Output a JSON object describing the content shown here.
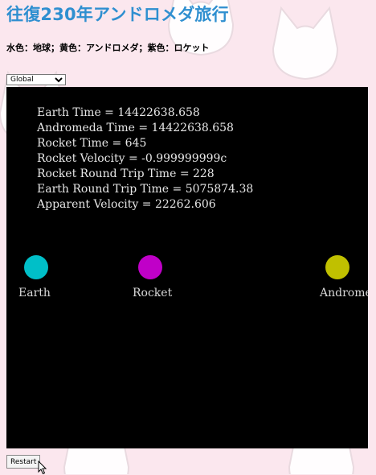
{
  "page": {
    "title": "往復230年アンドロメダ旅行",
    "legend": "水色：地球；黄色：アンドロメダ；紫色：ロケット"
  },
  "controls": {
    "frame_select": {
      "selected": "Global",
      "options": [
        "Global"
      ]
    },
    "restart_label": "Restart"
  },
  "simulation": {
    "readouts": [
      "Earth Time = 14422638.658",
      "Andromeda Time = 14422638.658",
      "Rocket Time = 645",
      "Rocket Velocity = -0.999999999c",
      "Rocket Round Trip Time = 228",
      "Earth Round Trip Time = 5075874.38",
      "Apparent Velocity = 22262.606"
    ],
    "bodies": {
      "earth": {
        "label": "Earth",
        "color": "#00bfc8"
      },
      "rocket": {
        "label": "Rocket",
        "color": "#c000c8"
      },
      "andromeda": {
        "label": "Andromeda",
        "color": "#c0c000"
      }
    }
  },
  "colors": {
    "title": "#2f8fd0",
    "canvas_bg": "#000000",
    "page_bg": "#fbe7ee"
  }
}
